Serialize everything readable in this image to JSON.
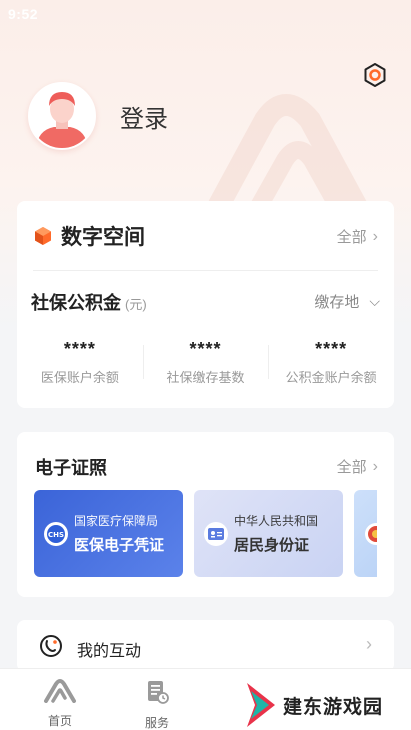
{
  "status": {
    "time": "9:52"
  },
  "profile": {
    "login_label": "登录"
  },
  "digital_space": {
    "title": "数字空间",
    "all_label": "全部",
    "social_security": {
      "title": "社保公积金",
      "unit": "(元)",
      "location_label": "缴存地",
      "stats": [
        {
          "value": "****",
          "label": "医保账户余额"
        },
        {
          "value": "****",
          "label": "社保缴存基数"
        },
        {
          "value": "****",
          "label": "公积金账户余额"
        }
      ]
    }
  },
  "e_certificates": {
    "title": "电子证照",
    "all_label": "全部",
    "cards": [
      {
        "issuer": "国家医疗保障局",
        "name": "医保电子凭证",
        "icon": "chs-logo-icon"
      },
      {
        "issuer": "中华人民共和国",
        "name": "居民身份证",
        "icon": "id-card-icon"
      }
    ]
  },
  "interactions": {
    "label": "我的互动"
  },
  "tabbar": {
    "items": [
      {
        "label": "首页",
        "icon": "home-logo-icon"
      },
      {
        "label": "服务",
        "icon": "service-doc-icon"
      }
    ]
  },
  "watermark": {
    "text": "建东游戏园"
  },
  "colors": {
    "accent": "#ff6a2a",
    "cert_blue": "#3b64d8",
    "bg": "#f4f5f7"
  }
}
